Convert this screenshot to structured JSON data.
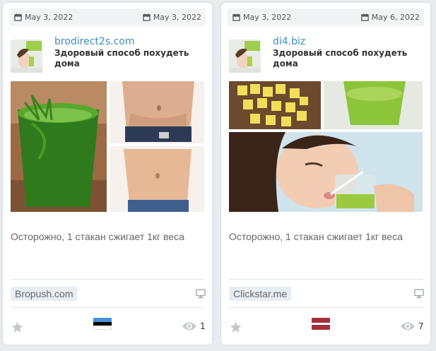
{
  "cards": [
    {
      "date_first": "May 3, 2022",
      "date_last": "May 3, 2022",
      "domain": "brodirect2s.com",
      "headline": "Здоровый способ похудеть дома",
      "ad_text": "Осторожно, 1 стакан сжигает 1кг веса",
      "network": "Bropush.com",
      "views": "1",
      "flag_colors": [
        "#4891d9",
        "#000000",
        "#ffffff"
      ],
      "creative": "green-smoothie-and-belly-collage"
    },
    {
      "date_first": "May 3, 2022",
      "date_last": "May 6, 2022",
      "domain": "di4.biz",
      "headline": "Здоровый способ похудеть дома",
      "ad_text": "Осторожно, 1 стакан сжигает 1кг веса",
      "network": "Clickstar.me",
      "views": "7",
      "flag_colors": [
        "#a2313d",
        "#ffffff",
        "#a2313d"
      ],
      "creative": "pineapple-juice-and-woman-drinking-collage"
    }
  ],
  "icons": {
    "date": "calendar-icon",
    "device": "desktop-monitor-icon",
    "favorite": "star-icon",
    "views": "eye-icon"
  },
  "colors": {
    "domain_link": "#3c8dbc",
    "network_badge_bg": "#e6eef3",
    "icon_gray": "#c5c9cd"
  }
}
